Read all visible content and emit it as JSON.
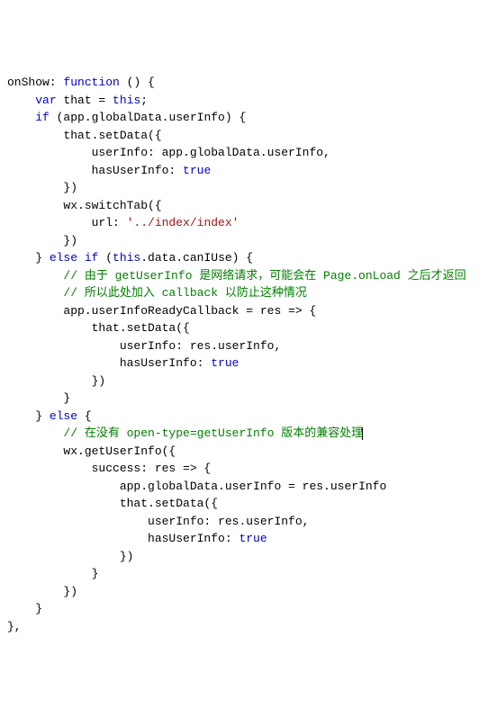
{
  "code": {
    "tokens": [
      [
        {
          "t": "onShow: ",
          "c": ""
        },
        {
          "t": "function",
          "c": "kw"
        },
        {
          "t": " () {",
          "c": ""
        }
      ],
      [
        {
          "t": "    ",
          "c": ""
        },
        {
          "t": "var",
          "c": "kw"
        },
        {
          "t": " that = ",
          "c": ""
        },
        {
          "t": "this",
          "c": "kw"
        },
        {
          "t": ";",
          "c": ""
        }
      ],
      [
        {
          "t": "    ",
          "c": ""
        },
        {
          "t": "if",
          "c": "kw"
        },
        {
          "t": " (app.globalData.userInfo) {",
          "c": ""
        }
      ],
      [
        {
          "t": "        that.setData({",
          "c": ""
        }
      ],
      [
        {
          "t": "            userInfo: app.globalData.userInfo,",
          "c": ""
        }
      ],
      [
        {
          "t": "            hasUserInfo: ",
          "c": ""
        },
        {
          "t": "true",
          "c": "kw"
        }
      ],
      [
        {
          "t": "        })",
          "c": ""
        }
      ],
      [
        {
          "t": "        wx.switchTab({",
          "c": ""
        }
      ],
      [
        {
          "t": "            url: ",
          "c": ""
        },
        {
          "t": "'../index/index'",
          "c": "str"
        }
      ],
      [
        {
          "t": "        })",
          "c": ""
        }
      ],
      [
        {
          "t": "    } ",
          "c": ""
        },
        {
          "t": "else if",
          "c": "kw"
        },
        {
          "t": " (",
          "c": ""
        },
        {
          "t": "this",
          "c": "kw"
        },
        {
          "t": ".data.canIUse) {",
          "c": ""
        }
      ],
      [
        {
          "t": "        ",
          "c": ""
        },
        {
          "t": "// 由于 getUserInfo 是网络请求，可能会在 Page.onLoad 之后才返回",
          "c": "cmt"
        }
      ],
      [
        {
          "t": "        ",
          "c": ""
        },
        {
          "t": "// 所以此处加入 callback 以防止这种情况",
          "c": "cmt"
        }
      ],
      [
        {
          "t": "        app.userInfoReadyCallback = res => {",
          "c": ""
        }
      ],
      [
        {
          "t": "            that.setData({",
          "c": ""
        }
      ],
      [
        {
          "t": "                userInfo: res.userInfo,",
          "c": ""
        }
      ],
      [
        {
          "t": "                hasUserInfo: ",
          "c": ""
        },
        {
          "t": "true",
          "c": "kw"
        }
      ],
      [
        {
          "t": "            })",
          "c": ""
        }
      ],
      [
        {
          "t": "        }",
          "c": ""
        }
      ],
      [
        {
          "t": "    } ",
          "c": ""
        },
        {
          "t": "else",
          "c": "kw"
        },
        {
          "t": " {",
          "c": ""
        }
      ],
      [
        {
          "t": "        ",
          "c": ""
        },
        {
          "t": "// 在没有 open-type=getUserInfo 版本的兼容处理",
          "c": "cmt",
          "cursor": true
        }
      ],
      [
        {
          "t": "        wx.getUserInfo({",
          "c": ""
        }
      ],
      [
        {
          "t": "            success: res => {",
          "c": ""
        }
      ],
      [
        {
          "t": "                app.globalData.userInfo = res.userInfo",
          "c": ""
        }
      ],
      [
        {
          "t": "                that.setData({",
          "c": ""
        }
      ],
      [
        {
          "t": "                    userInfo: res.userInfo,",
          "c": ""
        }
      ],
      [
        {
          "t": "                    hasUserInfo: ",
          "c": ""
        },
        {
          "t": "true",
          "c": "kw"
        }
      ],
      [
        {
          "t": "                })",
          "c": ""
        }
      ],
      [
        {
          "t": "            }",
          "c": ""
        }
      ],
      [
        {
          "t": "        })",
          "c": ""
        }
      ],
      [
        {
          "t": "    }",
          "c": ""
        }
      ],
      [
        {
          "t": "},",
          "c": ""
        }
      ]
    ]
  }
}
